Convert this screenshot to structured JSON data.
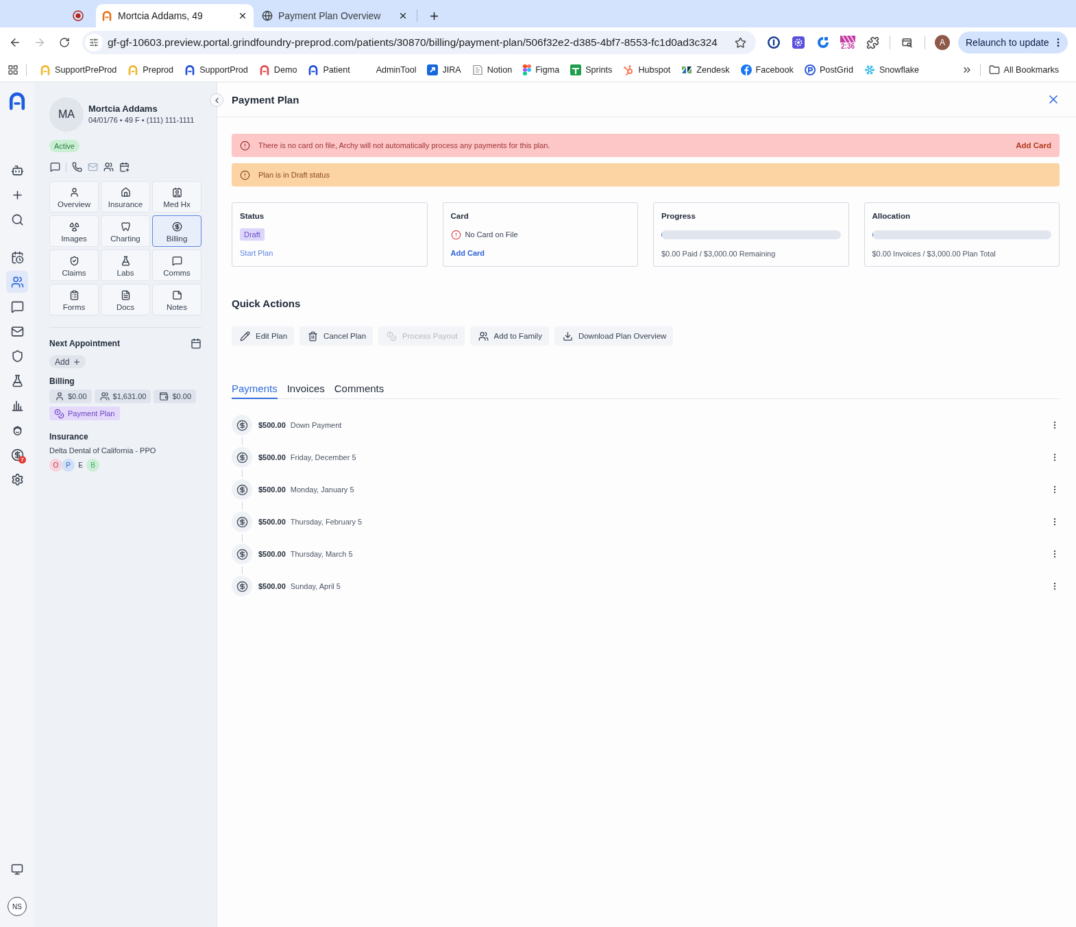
{
  "browser": {
    "tabs": [
      {
        "title": "Mortcia Addams, 49",
        "kind": "arch",
        "selected": true
      },
      {
        "title": "Payment Plan Overview",
        "kind": "globe",
        "selected": false
      }
    ],
    "forward": {
      "disabled": true
    },
    "url": "gf-gf-10603.preview.portal.grindfoundry-preprod.com/patients/30870/billing/payment-plan/506f32e2-d385-4bf7-8553-fc1d0ad3c324",
    "extensions": [
      {
        "kind": "keyhole"
      },
      {
        "kind": "gear-tile"
      },
      {
        "kind": "swirl"
      },
      {
        "kind": "timer",
        "label": "2:36"
      },
      {
        "kind": "puzzle"
      }
    ],
    "profile": "A",
    "relaunch": "Relaunch to update",
    "bookmarks": [
      {
        "label": "SupportPreProd",
        "kind": "arch",
        "color": "#f0b62b"
      },
      {
        "label": "Preprod",
        "kind": "arch",
        "color": "#f0b62b"
      },
      {
        "label": "SupportProd",
        "kind": "arch",
        "color": "#1d4ed8"
      },
      {
        "label": "Demo",
        "kind": "arch",
        "color": "#e5484d"
      },
      {
        "label": "Patient",
        "kind": "arch",
        "color": "#1d4ed8"
      },
      {
        "label": "AdminTool",
        "kind": "blank"
      },
      {
        "label": "JIRA",
        "kind": "tile"
      },
      {
        "label": "Notion",
        "kind": "page"
      },
      {
        "label": "Figma",
        "kind": "shapes"
      },
      {
        "label": "Sprints",
        "kind": "cross"
      },
      {
        "label": "Hubspot",
        "kind": "sprocket"
      },
      {
        "label": "Zendesk",
        "kind": "slashes"
      },
      {
        "label": "Facebook",
        "kind": "f-circle"
      },
      {
        "label": "PostGrid",
        "kind": "p-circle"
      },
      {
        "label": "Snowflake",
        "kind": "snowflake"
      }
    ],
    "all_bookmarks": "All Bookmarks"
  },
  "rail": {
    "actions": [
      {
        "kind": "bot"
      },
      {
        "kind": "plus"
      },
      {
        "kind": "search"
      }
    ],
    "nav": [
      {
        "kind": "schedule",
        "selected": false
      },
      {
        "kind": "patients",
        "selected": true
      },
      {
        "kind": "chat",
        "selected": false
      },
      {
        "kind": "mail",
        "selected": false
      },
      {
        "kind": "shield",
        "selected": false
      },
      {
        "kind": "flask",
        "selected": false
      },
      {
        "kind": "chart",
        "selected": false
      },
      {
        "kind": "doctor",
        "selected": false
      },
      {
        "kind": "dollar",
        "selected": false,
        "badge": "7"
      },
      {
        "kind": "settings",
        "selected": false
      }
    ],
    "user": "NS"
  },
  "patient": {
    "initials": "MA",
    "name": "Mortcia Addams",
    "details": "04/01/76 • 49 F • (111) 111-1111",
    "status": "Active",
    "contact_actions": [
      {
        "kind": "chat",
        "disabled": false
      },
      {
        "kind": "phone",
        "disabled": false
      },
      {
        "kind": "mail",
        "disabled": true
      },
      {
        "kind": "family",
        "disabled": false
      },
      {
        "kind": "calendar-add",
        "disabled": false
      }
    ],
    "nav": [
      {
        "label": "Overview",
        "kind": "overview",
        "selected": false
      },
      {
        "label": "Insurance",
        "kind": "insurance",
        "selected": false
      },
      {
        "label": "Med Hx",
        "kind": "medhx",
        "selected": false
      },
      {
        "label": "Images",
        "kind": "images",
        "selected": false
      },
      {
        "label": "Charting",
        "kind": "charting",
        "selected": false
      },
      {
        "label": "Billing",
        "kind": "billing",
        "selected": true
      },
      {
        "label": "Claims",
        "kind": "claims",
        "selected": false
      },
      {
        "label": "Labs",
        "kind": "labs",
        "selected": false
      },
      {
        "label": "Comms",
        "kind": "comms",
        "selected": false
      },
      {
        "label": "Forms",
        "kind": "forms",
        "selected": false
      },
      {
        "label": "Docs",
        "kind": "docs",
        "selected": false
      },
      {
        "label": "Notes",
        "kind": "notes",
        "selected": false
      }
    ],
    "next_appointment": {
      "title": "Next Appointment",
      "add": "Add"
    },
    "billing": {
      "title": "Billing",
      "balances": [
        {
          "kind": "patient",
          "amount": "$0.00"
        },
        {
          "kind": "family",
          "amount": "$1,631.00"
        },
        {
          "kind": "wallet",
          "amount": "$0.00"
        }
      ],
      "plan_tag": "Payment Plan"
    },
    "insurance": {
      "title": "Insurance",
      "carrier": "Delta Dental of California - PPO",
      "coverages": [
        {
          "letter": "O",
          "color": "#f8d3dc"
        },
        {
          "letter": "P",
          "color": "#cfe0fb"
        },
        {
          "letter": "E"
        },
        {
          "letter": "B",
          "color": "#cdeed6"
        }
      ]
    }
  },
  "panel": {
    "title": "Payment Plan",
    "alerts": [
      {
        "kind": "error",
        "message": "There is no card on file, Archy will not automatically process any payments for this plan.",
        "action": "Add Card"
      },
      {
        "kind": "warning",
        "message": "Plan is in Draft status"
      }
    ],
    "summary_cards": [
      {
        "kind": "status",
        "title": "Status",
        "badge": "Draft",
        "link": "Start Plan"
      },
      {
        "kind": "card",
        "title": "Card",
        "message": "No Card on File",
        "link": "Add Card"
      },
      {
        "kind": "meter",
        "title": "Progress",
        "level": 0,
        "caption": "$0.00 Paid / $3,000.00 Remaining"
      },
      {
        "kind": "meter",
        "title": "Allocation",
        "level": 0,
        "caption": "$0.00 Invoices / $3,000.00 Plan Total"
      }
    ],
    "quick_actions": {
      "title": "Quick Actions",
      "buttons": [
        {
          "label": "Edit Plan",
          "kind": "edit",
          "disabled": false
        },
        {
          "label": "Cancel Plan",
          "kind": "delete",
          "disabled": false
        },
        {
          "label": "Process Payout",
          "kind": "payout",
          "disabled": true
        },
        {
          "label": "Add to Family",
          "kind": "family",
          "disabled": false
        },
        {
          "label": "Download Plan Overview",
          "kind": "download",
          "disabled": false
        }
      ]
    },
    "tabs": [
      {
        "label": "Payments",
        "selected": true
      },
      {
        "label": "Invoices",
        "selected": false
      },
      {
        "label": "Comments",
        "selected": false
      }
    ],
    "payments": [
      {
        "amount": "$500.00",
        "label": "Down Payment"
      },
      {
        "amount": "$500.00",
        "label": "Friday, December 5"
      },
      {
        "amount": "$500.00",
        "label": "Monday, January 5"
      },
      {
        "amount": "$500.00",
        "label": "Thursday, February 5"
      },
      {
        "amount": "$500.00",
        "label": "Thursday, March 5"
      },
      {
        "amount": "$500.00",
        "label": "Sunday, April 5"
      }
    ]
  }
}
